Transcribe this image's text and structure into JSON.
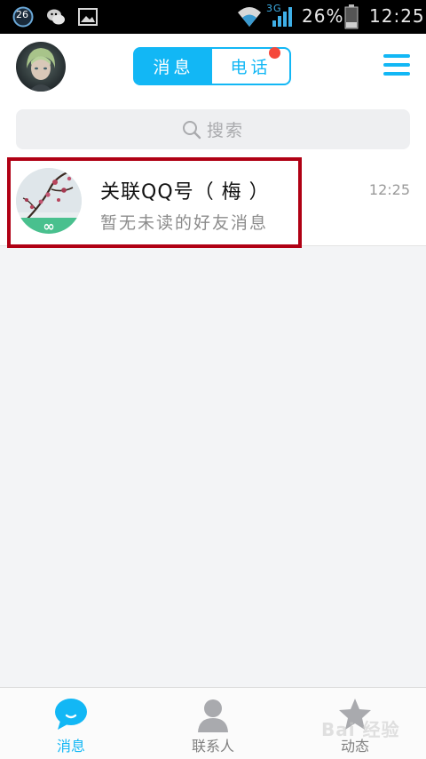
{
  "status_bar": {
    "badge_number": "26",
    "network_type": "3G",
    "battery": "26%",
    "time": "12:25"
  },
  "header": {
    "tabs": [
      {
        "label": "消息",
        "active": true
      },
      {
        "label": "电话",
        "active": false,
        "has_notification_dot": true
      }
    ],
    "menu_icon": "hamburger-icon"
  },
  "search": {
    "placeholder": "搜索"
  },
  "conversations": [
    {
      "title": "关联QQ号（ 梅 ）",
      "subtitle": "暂无未读的好友消息",
      "time": "12:25",
      "highlighted": true
    }
  ],
  "bottom_nav": {
    "items": [
      {
        "label": "消息",
        "icon": "chat-bubble-icon",
        "active": true
      },
      {
        "label": "联系人",
        "icon": "person-icon",
        "active": false
      },
      {
        "label": "动态",
        "icon": "star-icon",
        "active": false
      }
    ]
  },
  "watermark": "Bai 经验",
  "colors": {
    "accent": "#12b7f5",
    "notification": "#f5483b",
    "highlight_border": "#b00014"
  }
}
